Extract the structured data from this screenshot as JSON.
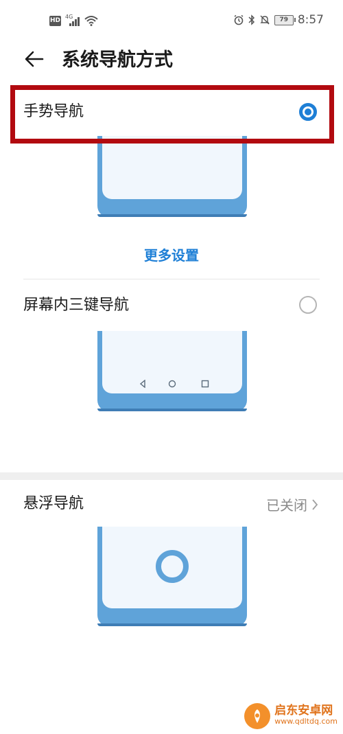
{
  "status_bar": {
    "hd_badge": "HD",
    "network": "4G",
    "battery": "79",
    "time": "8:57"
  },
  "header": {
    "title": "系统导航方式"
  },
  "options": {
    "gesture": {
      "label": "手势导航",
      "selected": true
    },
    "more_settings": "更多设置",
    "three_key": {
      "label": "屏幕内三键导航",
      "selected": false
    },
    "floating": {
      "label": "悬浮导航",
      "value": "已关闭"
    }
  },
  "watermark": {
    "main": "启东安卓网",
    "sub": "www.qdltdq.com"
  },
  "colors": {
    "accent": "#1e7fd6",
    "highlight_box": "#b20a10",
    "phone_frame": "#5fa3d9",
    "phone_screen": "#f1f7fd"
  }
}
